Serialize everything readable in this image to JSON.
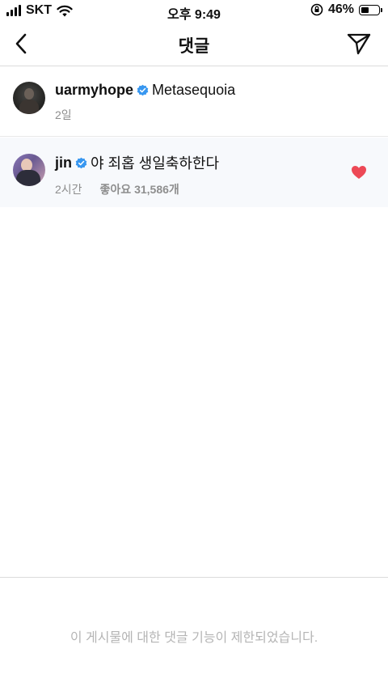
{
  "status_bar": {
    "carrier": "SKT",
    "time": "오후 9:49",
    "battery_percent": "46%",
    "battery_level": 0.46
  },
  "header": {
    "title": "댓글"
  },
  "caption": {
    "username": "uarmyhope",
    "text": "Metasequoia",
    "time": "2일"
  },
  "comments": [
    {
      "username": "jin",
      "text": "야 죄홉 생일축하한다",
      "time": "2시간",
      "likes": "좋아요 31,586개",
      "liked": true
    }
  ],
  "footer": {
    "restricted_message": "이 게시물에 대한 댓글 기능이 제한되었습니다."
  },
  "colors": {
    "verified": "#3897f0",
    "heart": "#ed4956",
    "muted_text": "#8e8e8e"
  }
}
